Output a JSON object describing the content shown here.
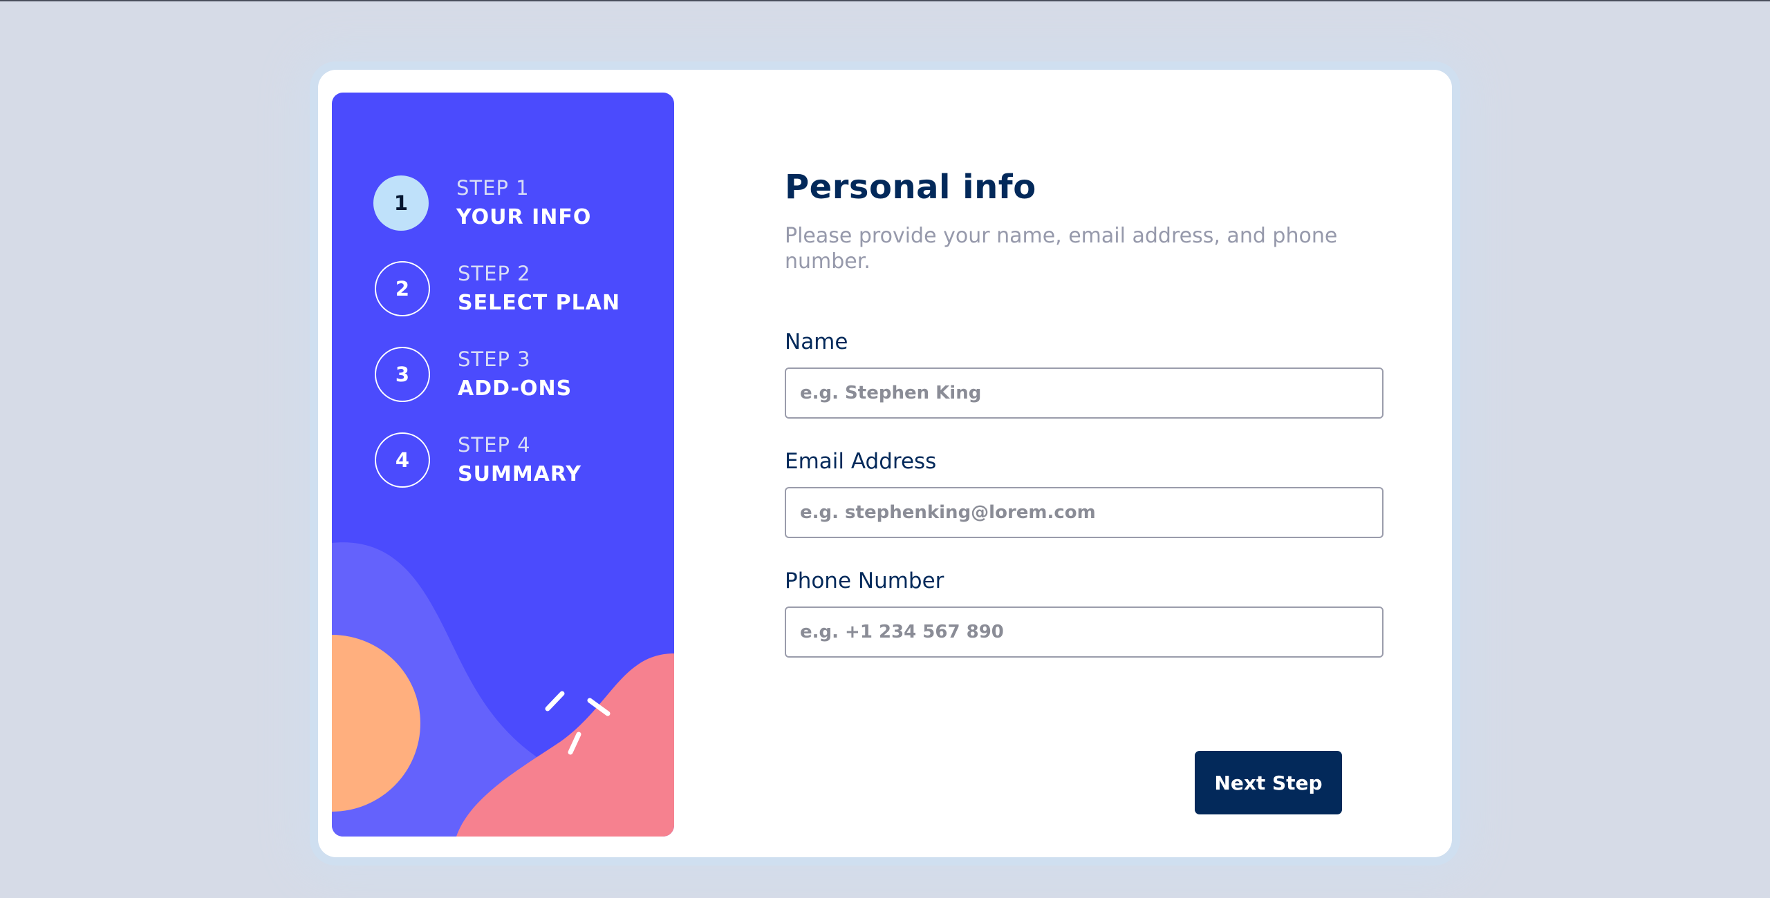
{
  "steps": [
    {
      "number": "1",
      "sub": "STEP 1",
      "label": "YOUR INFO"
    },
    {
      "number": "2",
      "sub": "STEP 2",
      "label": "SELECT PLAN"
    },
    {
      "number": "3",
      "sub": "STEP 3",
      "label": "ADD-ONS"
    },
    {
      "number": "4",
      "sub": "STEP 4",
      "label": "SUMMARY"
    }
  ],
  "active_step": 1,
  "form": {
    "title": "Personal info",
    "subtitle": "Please provide your name, email address, and phone number.",
    "fields": [
      {
        "label": "Name",
        "value": "",
        "placeholder": "e.g. Stephen King"
      },
      {
        "label": "Email Address",
        "value": "",
        "placeholder": "e.g. stephenking@lorem.com"
      },
      {
        "label": "Phone Number",
        "value": "",
        "placeholder": "e.g. +1 234 567 890"
      }
    ],
    "next_label": "Next Step"
  },
  "colors": {
    "page_background": "#d6dbe7",
    "sidebar": "#4b4bfd",
    "active_step": "#bfe1fa",
    "primary_navy": "#03295a",
    "muted_text": "#9699ab",
    "orange_shape": "#ffaf7e",
    "pink_shape": "#f6818f",
    "violet_shape": "#6462fc"
  },
  "icons": {
    "sidebar_decor": "decorative-shapes-illustration"
  }
}
